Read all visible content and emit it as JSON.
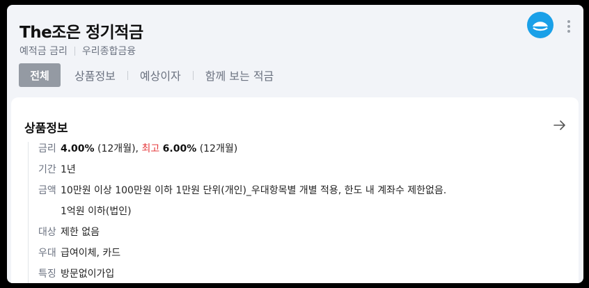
{
  "header": {
    "title": "The조은 정기적금",
    "category": "예적금 금리",
    "bank": "우리종합금융"
  },
  "tabs": [
    {
      "label": "전체",
      "active": true
    },
    {
      "label": "상품정보",
      "active": false
    },
    {
      "label": "예상이자",
      "active": false
    },
    {
      "label": "함께 보는 적금",
      "active": false
    }
  ],
  "card": {
    "title": "상품정보",
    "rows": {
      "rate": {
        "key": "금리",
        "base": "4.00%",
        "base_term": "(12개월),",
        "max_label": "최고",
        "max": "6.00%",
        "max_term": "(12개월)"
      },
      "period": {
        "key": "기간",
        "value": "1년"
      },
      "amount": {
        "key": "금액",
        "line1": "10만원 이상 100만원 이하 1만원 단위(개인)_우대항목별 개별 적용, 한도 내 계좌수 제한없음.",
        "line2": "1억원 이하(법인)"
      },
      "target": {
        "key": "대상",
        "value": "제한 없음"
      },
      "benefit": {
        "key": "우대",
        "value": "급여이체, 카드"
      },
      "feature": {
        "key": "특징",
        "value": "방문없이가입"
      }
    }
  },
  "colors": {
    "accent_red": "#e5383b",
    "logo_blue": "#1aa0e8",
    "active_tab_bg": "#949aa3"
  },
  "icons": [
    "bank-logo-icon",
    "more-vertical-icon",
    "arrow-right-icon"
  ]
}
